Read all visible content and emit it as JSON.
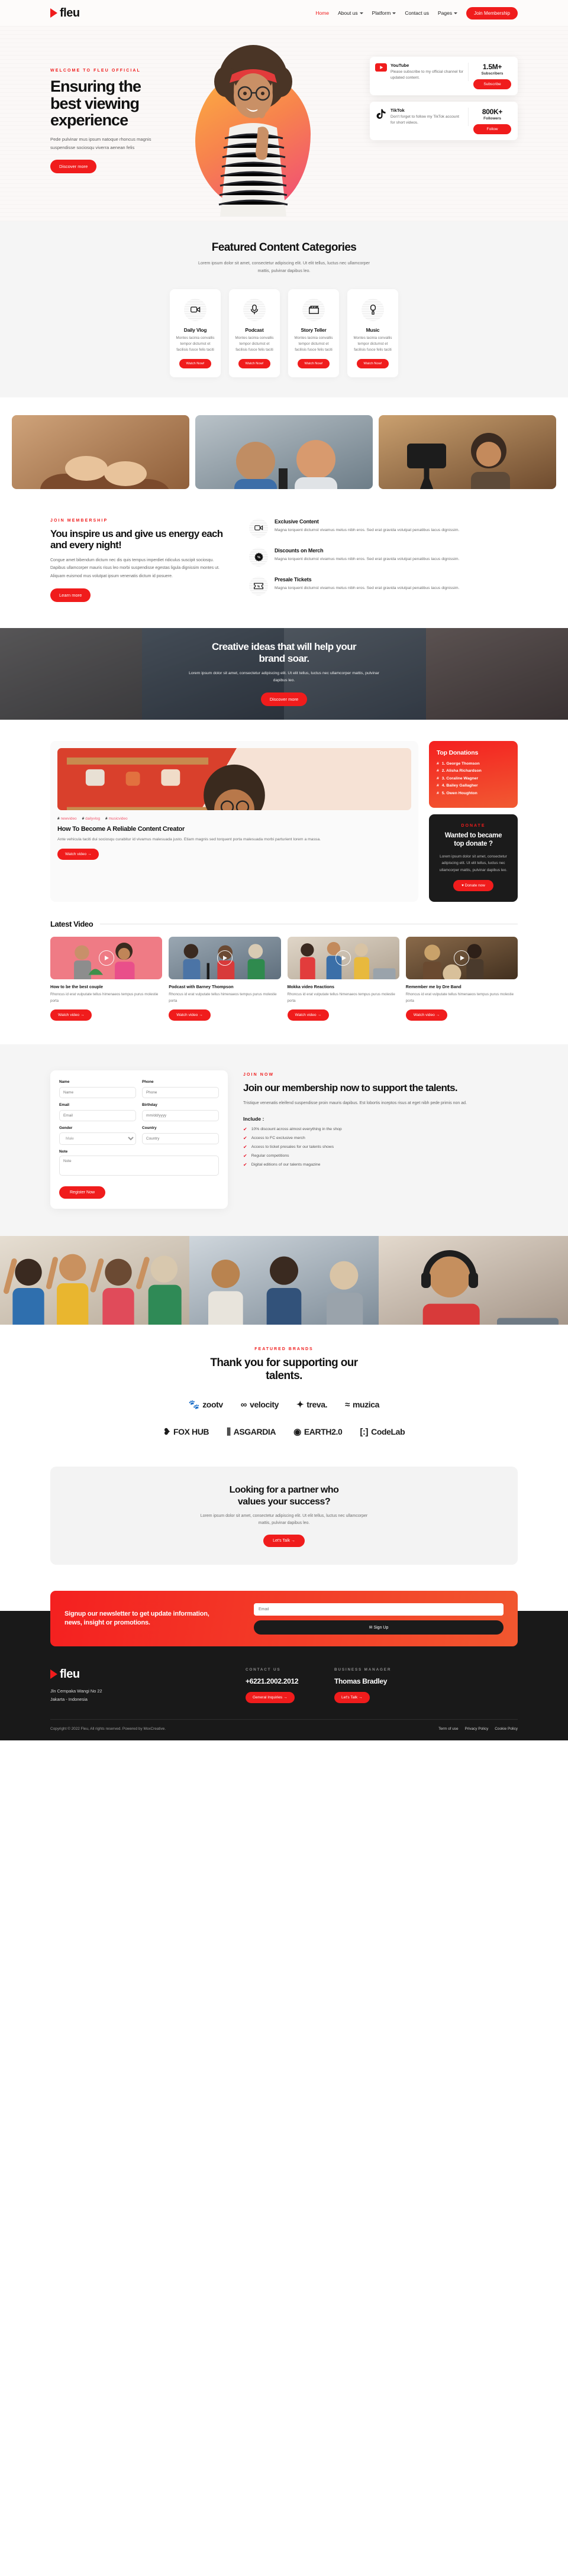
{
  "brand": {
    "name": "fleu",
    "logo_icon": "play-triangle-icon"
  },
  "nav": {
    "items": [
      {
        "label": "Home",
        "active": true,
        "caret": false
      },
      {
        "label": "About us",
        "active": false,
        "caret": true
      },
      {
        "label": "Platform",
        "active": false,
        "caret": true
      },
      {
        "label": "Contact us",
        "active": false,
        "caret": false
      },
      {
        "label": "Pages",
        "active": false,
        "caret": true
      }
    ],
    "cta": "Join Membership"
  },
  "hero": {
    "eyebrow": "WELCOME TO FLEU OFFICIAL",
    "title_line1": "Ensuring the",
    "title_line2": "best viewing",
    "title_line3": "experience",
    "description": "Pede pulvinar mus ipsum natoque rhoncus magnis suspendisse sociosqu viverra aenean felis",
    "cta": "Discover more",
    "stat_cards": [
      {
        "icon": "youtube-icon",
        "name": "YouTube",
        "description": "Please subscribe to my official channel for updated content.",
        "count": "1.5M+",
        "count_label": "Subscribers",
        "button": "Subscribe"
      },
      {
        "icon": "tiktok-icon",
        "name": "TikTok",
        "description": "Don't forget to follow my TikTok account for short videos.",
        "count": "800K+",
        "count_label": "Followers",
        "button": "Follow"
      }
    ]
  },
  "categories": {
    "title": "Featured Content Categories",
    "description": "Lorem ipsum dolor sit amet, consectetur adipiscing elit. Ut elit tellus, luctus nec ullamcorper mattis, pulvinar dapibus leo.",
    "items": [
      {
        "icon": "video-camera-icon",
        "name": "Daily Vlog",
        "description": "Montes lacinia convallis tempor dictumst et facilisis fusce felis taciti",
        "button": "Watch Now!"
      },
      {
        "icon": "microphone-icon",
        "name": "Podcast",
        "description": "Montes lacinia convallis tempor dictumst et facilisis fusce felis taciti",
        "button": "Watch Now!"
      },
      {
        "icon": "clapperboard-icon",
        "name": "Story Teller",
        "description": "Montes lacinia convallis tempor dictumst et facilisis fusce felis taciti",
        "button": "Watch Now!"
      },
      {
        "icon": "mic-handheld-icon",
        "name": "Music",
        "description": "Montes lacinia convallis tempor dictumst et facilisis fusce felis taciti",
        "button": "Watch Now!"
      }
    ]
  },
  "inspire": {
    "eyebrow": "JOIN MEMBERSHIP",
    "title": "You inspire us and give us energy each and every night!",
    "description": "Congue amet bibendum dictum nec dis quis tempus imperdiet ridiculus suscipit sociosqu. Dapibus ullamcorper mauris risus leo morbi suspendisse egestas ligula dignissim montes ut. Aliquam euismod mus volutpat ipsum venenatis dictum id posuere.",
    "cta": "Learn more",
    "features": [
      {
        "icon": "video-camera-icon",
        "title": "Exclusive Content",
        "description": "Magna torquent dictumst vivamus metus nibh eros. Sed erat gravida volutpat penatibus lacus dignissim."
      },
      {
        "icon": "discount-badge-icon",
        "title": "Discounts on Merch",
        "description": "Magna torquent dictumst vivamus metus nibh eros. Sed erat gravida volutpat penatibus lacus dignissim."
      },
      {
        "icon": "ticket-icon",
        "title": "Presale Tickets",
        "description": "Magna torquent dictumst vivamus metus nibh eros. Sed erat gravida volutpat penatibus lacus dignissim."
      }
    ]
  },
  "banner": {
    "title_line1": "Creative ideas that will help your",
    "title_line2": "brand soar.",
    "description": "Lorem ipsum dolor sit amet, consectetur adipiscing elit. Ut elit tellus, luctus nec ullamcorper mattis, pulvinar dapibus leo.",
    "cta": "Discover more"
  },
  "article": {
    "tags": [
      "newvideo",
      "dailyvlog",
      "musicvideo"
    ],
    "title": "How To Become A Reliable Content Creator",
    "description": "Ante vehicula taciti dui sociosqu curabitur id vivamus malesuada justo. Etiam magnis sed torquent porta malesuada morbi parturient lorem a massa.",
    "cta": "Watch video  →"
  },
  "donations": {
    "title": "Top Donations",
    "items": [
      "1. George Thomson",
      "2. Alisha Richardson",
      "3. Coraline Wagner",
      "4. Bailey Gallagher",
      "5. Owen Houghton"
    ],
    "promo": {
      "eyebrow": "DONATE",
      "title_line1": "Wanted to became",
      "title_line2": "top donate ?",
      "description": "Lorem ipsum dolor sit amet, consectetur adipiscing elit. Ut elit tellus, luctus nec ullamcorper mattis, pulvinar dapibus leo.",
      "cta": "♥  Donate now"
    }
  },
  "latest_video": {
    "title": "Latest Video",
    "items": [
      {
        "title": "How to be the best couple",
        "description": "Rhoncus id erat vulputate tellus himenaeos tempus purus molestie porta",
        "cta": "Watch video  →"
      },
      {
        "title": "Podcast with Barney Thompson",
        "description": "Rhoncus id erat vulputate tellus himenaeos tempus purus molestie porta",
        "cta": "Watch video  →"
      },
      {
        "title": "Mokka video Reactions",
        "description": "Rhoncus id erat vulputate tellus himenaeos tempus purus molestie porta",
        "cta": "Watch video  →"
      },
      {
        "title": "Remember me by Dre Band",
        "description": "Rhoncus id erat vulputate tellus himenaeos tempus purus molestie porta",
        "cta": "Watch video  →"
      }
    ]
  },
  "membership": {
    "eyebrow": "JOIN NOW",
    "title": "Join our membership now to support the talents.",
    "description": "Tristique venenatis eleifend suspendisse proin mauris dapibus. Est lobortis inceptos risus at eget nibh pede primis non ad.",
    "include_label": "Include :",
    "benefits": [
      "10% discount across almost everything in the shop",
      "Access to FC exclusive merch",
      "Access to ticket presales for our talents shows",
      "Regular competitions",
      "Digital editions of our talents magazine"
    ],
    "form": {
      "fields": [
        {
          "label": "Name",
          "placeholder": "Name",
          "type": "text"
        },
        {
          "label": "Phone",
          "placeholder": "Phone",
          "type": "text"
        },
        {
          "label": "Email",
          "placeholder": "Email",
          "type": "text"
        },
        {
          "label": "Birthday",
          "placeholder": "mm/dd/yyyy",
          "type": "date"
        },
        {
          "label": "Gender",
          "value": "Male",
          "type": "select"
        },
        {
          "label": "Country",
          "placeholder": "Country",
          "type": "text"
        },
        {
          "label": "Note",
          "placeholder": "Note",
          "type": "textarea"
        }
      ],
      "submit": "Register Now"
    }
  },
  "brands": {
    "eyebrow": "FEATURED BRANDS",
    "title_line1": "Thank you for supporting our",
    "title_line2": "talents.",
    "items": [
      {
        "icon": "paw-icon",
        "name": "zootv"
      },
      {
        "icon": "infinity-icon",
        "name": "velocity"
      },
      {
        "icon": "leaf-icon",
        "name": "treva."
      },
      {
        "icon": "wave-icon",
        "name": "muzica"
      },
      {
        "icon": "fox-icon",
        "name": "FOX HUB"
      },
      {
        "icon": "shield-icon",
        "name": "ASGARDIA"
      },
      {
        "icon": "globe-icon",
        "name": "EARTH2.0"
      },
      {
        "icon": "bracket-icon",
        "name": "CodeLab"
      }
    ]
  },
  "partner": {
    "title_line1": "Looking for a partner who",
    "title_line2": "values your success?",
    "description": "Lorem ipsum dolor sit amet, consectetur adipiscing elit. Ut elit tellus, luctus nec ullamcorper mattis, pulvinar dapibus leo.",
    "cta": "Let's Talk  →"
  },
  "newsletter": {
    "title_line1": "Signup our newsletter to get update information,",
    "title_line2": "news, insight or promotions.",
    "placeholder": "Email",
    "button": "✉  Sign Up"
  },
  "footer": {
    "address_line1": "Jln Cempaka Wangi No 22",
    "address_line2": "Jakarta - Indonesia",
    "contact": {
      "head": "CONTACT US",
      "value": "+6221.2002.2012",
      "cta": "General Inquiries  →"
    },
    "manager": {
      "head": "BUSINESS MANAGER",
      "value": "Thomas Bradley",
      "cta": "Let's Talk  →"
    },
    "copyright": "Copyright © 2022 Fleu, All rights reserved. Powered by MoxCreative.",
    "links": [
      "Term of use",
      "Privacy Policy",
      "Cookie Policy"
    ]
  },
  "colors": {
    "accent": "#f01c1c",
    "dark": "#191919",
    "gray_bg": "#f5f5f5"
  }
}
